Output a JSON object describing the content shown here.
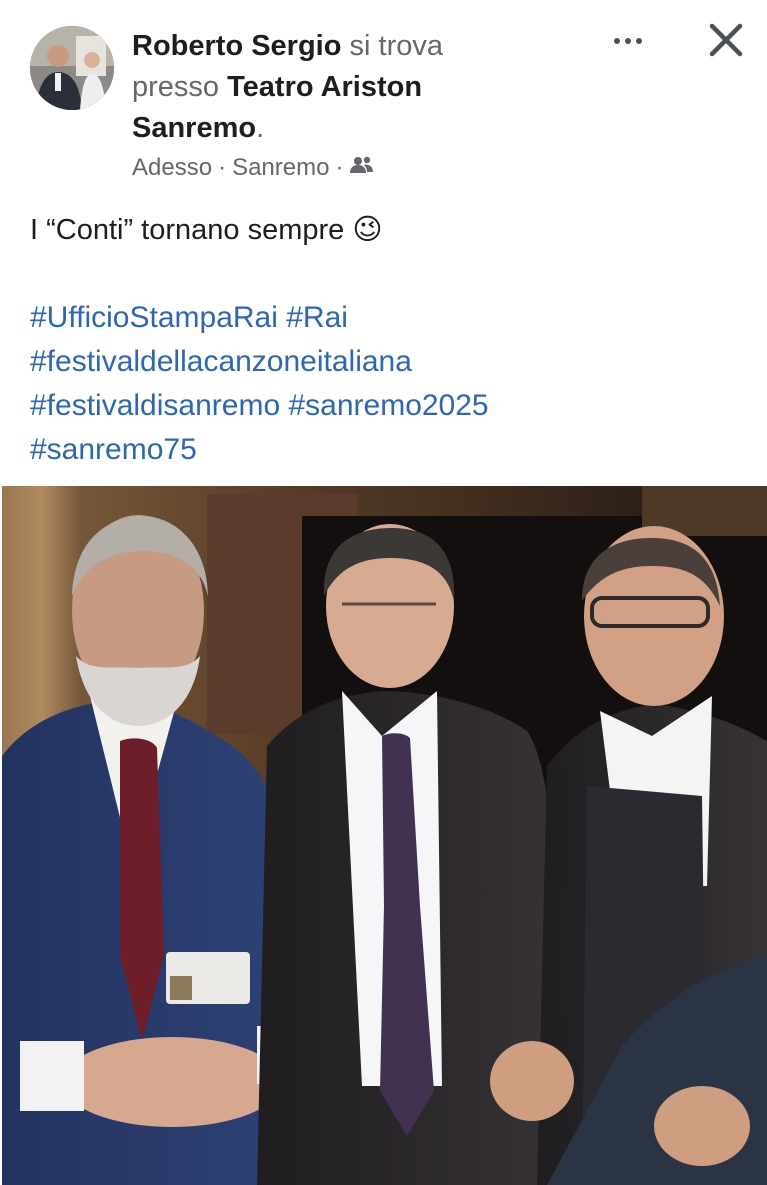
{
  "post": {
    "author": "Roberto Sergio",
    "location_prefix": "si trova presso",
    "location": "Teatro Ariston Sanremo",
    "location_suffix": ".",
    "time": "Adesso",
    "separator": "·",
    "place": "Sanremo",
    "audience_icon": "friends-icon",
    "text": "I “Conti” tornano sempre",
    "emoji": "😉",
    "hashtags": [
      "#UfficioStampaRai",
      "#Rai",
      "#festivaldellacanzoneitaliana",
      "#festivaldisanremo",
      "#sanremo2025",
      "#sanremo75"
    ]
  },
  "actions": {
    "more_icon": "more-dots-icon",
    "close_icon": "close-icon"
  },
  "colors": {
    "hashtag": "#2b66b8",
    "muted": "#65676b",
    "text": "#1c1e21"
  }
}
